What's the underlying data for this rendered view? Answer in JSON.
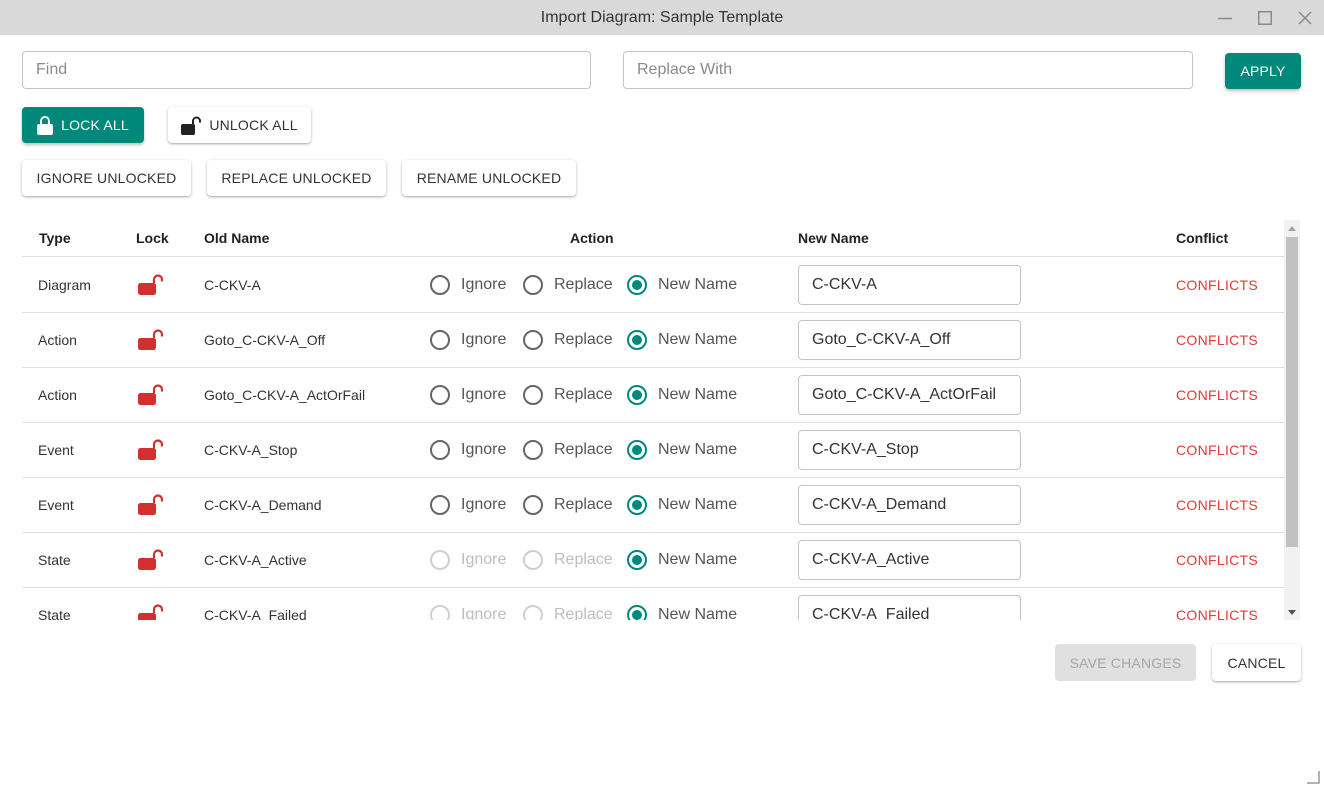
{
  "window": {
    "title": "Import Diagram: Sample Template"
  },
  "toolbar": {
    "find_placeholder": "Find",
    "find_value": "",
    "replace_placeholder": "Replace With",
    "replace_value": "",
    "apply_label": "APPLY",
    "lock_all_label": "LOCK ALL",
    "unlock_all_label": "UNLOCK ALL",
    "ignore_unlocked_label": "IGNORE UNLOCKED",
    "replace_unlocked_label": "REPLACE UNLOCKED",
    "rename_unlocked_label": "RENAME UNLOCKED"
  },
  "table": {
    "headers": {
      "type": "Type",
      "lock": "Lock",
      "old_name": "Old Name",
      "action": "Action",
      "new_name": "New Name",
      "conflict": "Conflict"
    },
    "option_labels": {
      "ignore": "Ignore",
      "replace": "Replace",
      "new_name": "New Name"
    },
    "rows": [
      {
        "type": "Diagram",
        "lock_icon": "unlocked-icon",
        "old_name": "C-CKV-A",
        "selected_action": "New Name",
        "ignore_enabled": true,
        "replace_enabled": true,
        "new_name": "C-CKV-A",
        "conflict": "CONFLICTS"
      },
      {
        "type": "Action",
        "lock_icon": "unlocked-icon",
        "old_name": "Goto_C-CKV-A_Off",
        "selected_action": "New Name",
        "ignore_enabled": true,
        "replace_enabled": true,
        "new_name": "Goto_C-CKV-A_Off",
        "conflict": "CONFLICTS"
      },
      {
        "type": "Action",
        "lock_icon": "unlocked-icon",
        "old_name": "Goto_C-CKV-A_ActOrFail",
        "selected_action": "New Name",
        "ignore_enabled": true,
        "replace_enabled": true,
        "new_name": "Goto_C-CKV-A_ActOrFail",
        "conflict": "CONFLICTS"
      },
      {
        "type": "Event",
        "lock_icon": "unlocked-icon",
        "old_name": "C-CKV-A_Stop",
        "selected_action": "New Name",
        "ignore_enabled": true,
        "replace_enabled": true,
        "new_name": "C-CKV-A_Stop",
        "conflict": "CONFLICTS"
      },
      {
        "type": "Event",
        "lock_icon": "unlocked-icon",
        "old_name": "C-CKV-A_Demand",
        "selected_action": "New Name",
        "ignore_enabled": true,
        "replace_enabled": true,
        "new_name": "C-CKV-A_Demand",
        "conflict": "CONFLICTS"
      },
      {
        "type": "State",
        "lock_icon": "unlocked-icon",
        "old_name": "C-CKV-A_Active",
        "selected_action": "New Name",
        "ignore_enabled": false,
        "replace_enabled": false,
        "new_name": "C-CKV-A_Active",
        "conflict": "CONFLICTS"
      },
      {
        "type": "State",
        "lock_icon": "unlocked-icon",
        "old_name": "C-CKV-A_Failed",
        "selected_action": "New Name",
        "ignore_enabled": false,
        "replace_enabled": false,
        "new_name": "C-CKV-A_Failed",
        "conflict": "CONFLICTS"
      }
    ]
  },
  "footer": {
    "save_label": "SAVE CHANGES",
    "save_enabled": false,
    "cancel_label": "CANCEL"
  },
  "colors": {
    "accent": "#00897b",
    "conflict": "#e53935",
    "lock_unlocked": "#d32f2f",
    "titlebar": "#d9d9d9",
    "disabled_bg": "#e0e0e0"
  }
}
